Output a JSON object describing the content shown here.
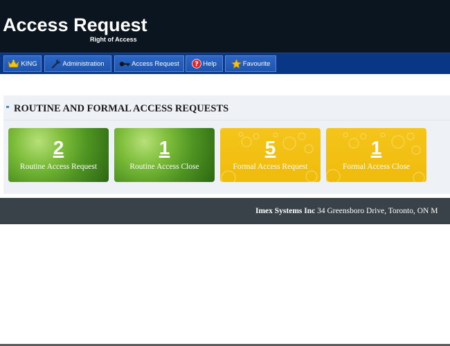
{
  "header": {
    "title": "Access Request",
    "subtitle": "Right of Access"
  },
  "nav": {
    "items": [
      {
        "label": "KING",
        "icon": "crown-icon"
      },
      {
        "label": "Administration",
        "icon": "wrench-icon"
      },
      {
        "label": "Access Request",
        "icon": "key-icon"
      },
      {
        "label": "Help",
        "icon": "help-icon"
      },
      {
        "label": "Favourite",
        "icon": "star-icon"
      }
    ]
  },
  "panel": {
    "title": "ROUTINE AND FORMAL ACCESS REQUESTS",
    "tiles": [
      {
        "count": "2",
        "label": "Routine Access Request",
        "color": "green"
      },
      {
        "count": "1",
        "label": "Routine Access Close",
        "color": "green"
      },
      {
        "count": "5",
        "label": "Formal Access Request",
        "color": "yellow"
      },
      {
        "count": "1",
        "label": "Formal Access Close",
        "color": "yellow"
      }
    ]
  },
  "footer": {
    "company": "Imex Systems Inc",
    "address": " 34 Greensboro Drive, Toronto, ON M"
  },
  "colors": {
    "header_bg": "#0b1520",
    "nav_bg": "#0a3785",
    "nav_button": "#2260bb",
    "tile_green": "#5fa52a",
    "tile_yellow": "#f2c014",
    "footer_bg": "#3a4249"
  }
}
